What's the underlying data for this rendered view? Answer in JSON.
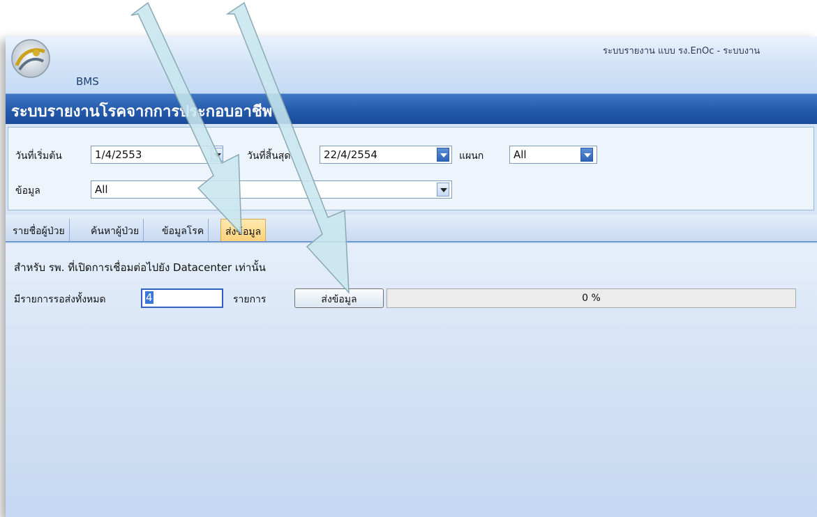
{
  "app": {
    "brand": "BMS",
    "window_title": "ระบบรายงาน แบบ รง.EnOc - ระบบงาน",
    "header_title": "ระบบรายงานโรคจากการประกอบอาชีพ"
  },
  "filters": {
    "start_date_label": "วันที่เริ่มต้น",
    "start_date_value": "1/4/2553",
    "end_date_label": "วันที่สิ้นสุด",
    "end_date_value": "22/4/2554",
    "department_label": "แผนก",
    "department_value": "All",
    "data_label": "ข้อมูล",
    "data_value": "All"
  },
  "tabs": [
    {
      "label": "รายชื่อผู้ป่วย"
    },
    {
      "label": "ค้นหาผู้ป่วย"
    },
    {
      "label": "ข้อมูลโรค"
    },
    {
      "label": "ส่งข้อมูล",
      "active": true
    }
  ],
  "send_panel": {
    "note": "สำหรับ รพ. ที่เปิดการเชื่อมต่อไปยัง Datacenter เท่านั้น",
    "pending_label": "มีรายการรอส่งทั้งหมด",
    "pending_count": "4",
    "items_unit": "รายการ",
    "send_button": "ส่งข้อมูล",
    "progress_percent": 0,
    "progress_text": "0 %"
  },
  "colors": {
    "header_blue": "#2459ab",
    "active_tab": "#ffd27a",
    "arrow_fill": "#c8e6ee"
  }
}
